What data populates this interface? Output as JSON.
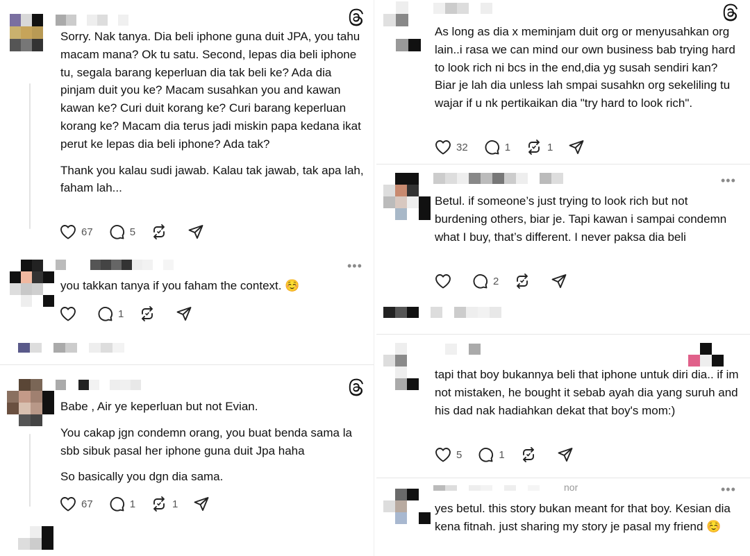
{
  "left": {
    "post1": {
      "paragraphs": [
        "Sorry. Nak tanya. Dia beli iphone guna duit JPA, you tahu macam mana? Ok tu satu. Second, lepas dia beli iphone tu, segala barang keperluan dia tak beli ke? Ada dia pinjam duit you ke? Macam susahkan you and kawan kawan ke? Curi duit korang ke? Curi barang keperluan korang ke? Macam dia terus jadi miskin papa kedana ikat perut ke lepas dia beli iphone? Ada tak?",
        "Thank you kalau sudi jawab. Kalau tak jawab, tak apa lah, faham lah..."
      ],
      "likes": "67",
      "replies": "5",
      "reposts": ""
    },
    "post2": {
      "text": "you takkan tanya if you faham the context. ☺️",
      "likes": "",
      "replies": "1",
      "reposts": ""
    },
    "post3": {
      "paragraphs": [
        "Babe , Air ye keperluan but not Evian.",
        "You cakap jgn condemn orang, you buat benda sama la sbb sibuk pasal her iphone guna duit Jpa haha",
        "So basically you dgn dia sama."
      ],
      "likes": "67",
      "replies": "1",
      "reposts": "1"
    }
  },
  "right": {
    "post1": {
      "text": "As long as dia x meminjam duit org or menyusahkan org lain..i rasa we can mind our own business bab trying hard to look rich ni bcs in the end,dia yg susah sendiri kan? Biar je lah dia unless lah smpai susahkn org sekeliling  tu wajar if u nk pertikaikan dia \"try hard to look rich\".",
      "likes": "32",
      "replies": "1",
      "reposts": "1"
    },
    "post2": {
      "text": "Betul. if someone’s just trying to look rich but not burdening others, biar je. Tapi kawan i sampai condemn what I buy, that’s different. I never paksa dia beli",
      "likes": "",
      "replies": "2",
      "reposts": ""
    },
    "post3": {
      "text": "tapi that boy bukannya beli that iphone untuk diri dia.. if im not mistaken, he bought it sebab ayah dia yang suruh and his dad nak hadiahkan dekat that boy's mom:)",
      "likes": "5",
      "replies": "1",
      "reposts": ""
    },
    "post4": {
      "username_fragment": "nor",
      "text": "yes betul. this story bukan meant for that boy. Kesian dia kena fitnah. just sharing my story je pasal my friend ☺️"
    }
  },
  "icons": {
    "like": "heart-icon",
    "reply": "comment-icon",
    "repost": "repost-icon",
    "share": "share-icon",
    "brand": "threads-logo-icon",
    "more": "more-icon"
  },
  "colors": {
    "text": "#111111",
    "muted": "#8a8a8a",
    "line": "#e3e3e3"
  }
}
